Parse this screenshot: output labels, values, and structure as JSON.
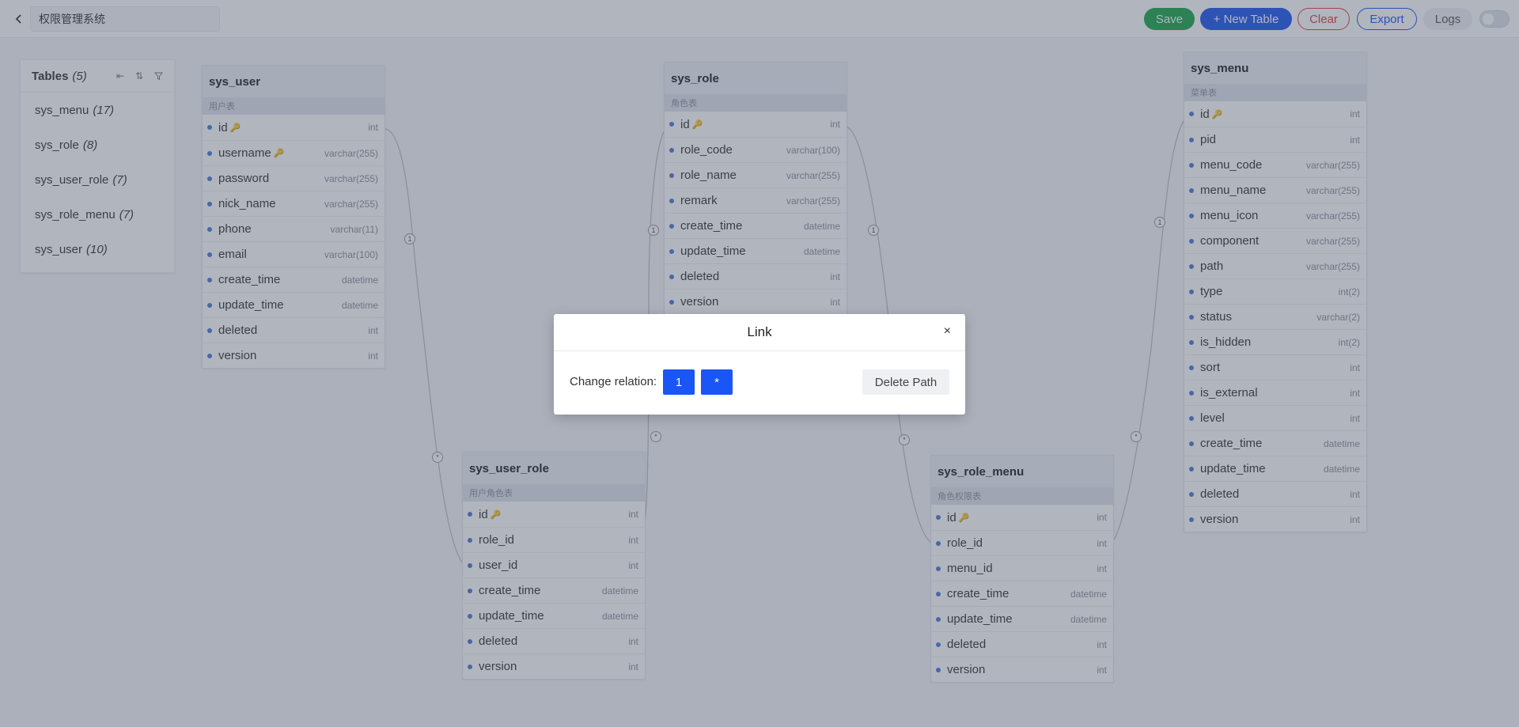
{
  "header": {
    "title_value": "权限管理系统",
    "buttons": {
      "save": "Save",
      "new_table": "+ New Table",
      "clear": "Clear",
      "export": "Export",
      "logs": "Logs"
    }
  },
  "tables_panel": {
    "title": "Tables",
    "count": "(5)",
    "items": [
      {
        "name": "sys_menu",
        "count": "(17)"
      },
      {
        "name": "sys_role",
        "count": "(8)"
      },
      {
        "name": "sys_user_role",
        "count": "(7)"
      },
      {
        "name": "sys_role_menu",
        "count": "(7)"
      },
      {
        "name": "sys_user",
        "count": "(10)"
      }
    ]
  },
  "tables": {
    "sys_user": {
      "name": "sys_user",
      "comment": "用户表",
      "fields": [
        {
          "name": "id",
          "type": "int",
          "key": true
        },
        {
          "name": "username",
          "type": "varchar(255)",
          "key": true
        },
        {
          "name": "password",
          "type": "varchar(255)"
        },
        {
          "name": "nick_name",
          "type": "varchar(255)"
        },
        {
          "name": "phone",
          "type": "varchar(11)"
        },
        {
          "name": "email",
          "type": "varchar(100)"
        },
        {
          "name": "create_time",
          "type": "datetime"
        },
        {
          "name": "update_time",
          "type": "datetime"
        },
        {
          "name": "deleted",
          "type": "int"
        },
        {
          "name": "version",
          "type": "int"
        }
      ]
    },
    "sys_role": {
      "name": "sys_role",
      "comment": "角色表",
      "fields": [
        {
          "name": "id",
          "type": "int",
          "key": true
        },
        {
          "name": "role_code",
          "type": "varchar(100)"
        },
        {
          "name": "role_name",
          "type": "varchar(255)"
        },
        {
          "name": "remark",
          "type": "varchar(255)"
        },
        {
          "name": "create_time",
          "type": "datetime"
        },
        {
          "name": "update_time",
          "type": "datetime"
        },
        {
          "name": "deleted",
          "type": "int"
        },
        {
          "name": "version",
          "type": "int"
        }
      ]
    },
    "sys_menu": {
      "name": "sys_menu",
      "comment": "菜单表",
      "fields": [
        {
          "name": "id",
          "type": "int",
          "key": true
        },
        {
          "name": "pid",
          "type": "int"
        },
        {
          "name": "menu_code",
          "type": "varchar(255)"
        },
        {
          "name": "menu_name",
          "type": "varchar(255)"
        },
        {
          "name": "menu_icon",
          "type": "varchar(255)"
        },
        {
          "name": "component",
          "type": "varchar(255)"
        },
        {
          "name": "path",
          "type": "varchar(255)"
        },
        {
          "name": "type",
          "type": "int(2)"
        },
        {
          "name": "status",
          "type": "varchar(2)"
        },
        {
          "name": "is_hidden",
          "type": "int(2)"
        },
        {
          "name": "sort",
          "type": "int"
        },
        {
          "name": "is_external",
          "type": "int"
        },
        {
          "name": "level",
          "type": "int"
        },
        {
          "name": "create_time",
          "type": "datetime"
        },
        {
          "name": "update_time",
          "type": "datetime"
        },
        {
          "name": "deleted",
          "type": "int"
        },
        {
          "name": "version",
          "type": "int"
        }
      ]
    },
    "sys_user_role": {
      "name": "sys_user_role",
      "comment": "用户角色表",
      "fields": [
        {
          "name": "id",
          "type": "int",
          "key": true
        },
        {
          "name": "role_id",
          "type": "int"
        },
        {
          "name": "user_id",
          "type": "int"
        },
        {
          "name": "create_time",
          "type": "datetime"
        },
        {
          "name": "update_time",
          "type": "datetime"
        },
        {
          "name": "deleted",
          "type": "int"
        },
        {
          "name": "version",
          "type": "int"
        }
      ]
    },
    "sys_role_menu": {
      "name": "sys_role_menu",
      "comment": "角色权限表",
      "fields": [
        {
          "name": "id",
          "type": "int",
          "key": true
        },
        {
          "name": "role_id",
          "type": "int"
        },
        {
          "name": "menu_id",
          "type": "int"
        },
        {
          "name": "create_time",
          "type": "datetime"
        },
        {
          "name": "update_time",
          "type": "datetime"
        },
        {
          "name": "deleted",
          "type": "int"
        },
        {
          "name": "version",
          "type": "int"
        }
      ]
    }
  },
  "relation_marks": {
    "one": "1",
    "many": "*"
  },
  "modal": {
    "title": "Link",
    "close": "×",
    "change_relation_label": "Change relation:",
    "option_one": "1",
    "option_many": "*",
    "delete_path": "Delete Path"
  }
}
